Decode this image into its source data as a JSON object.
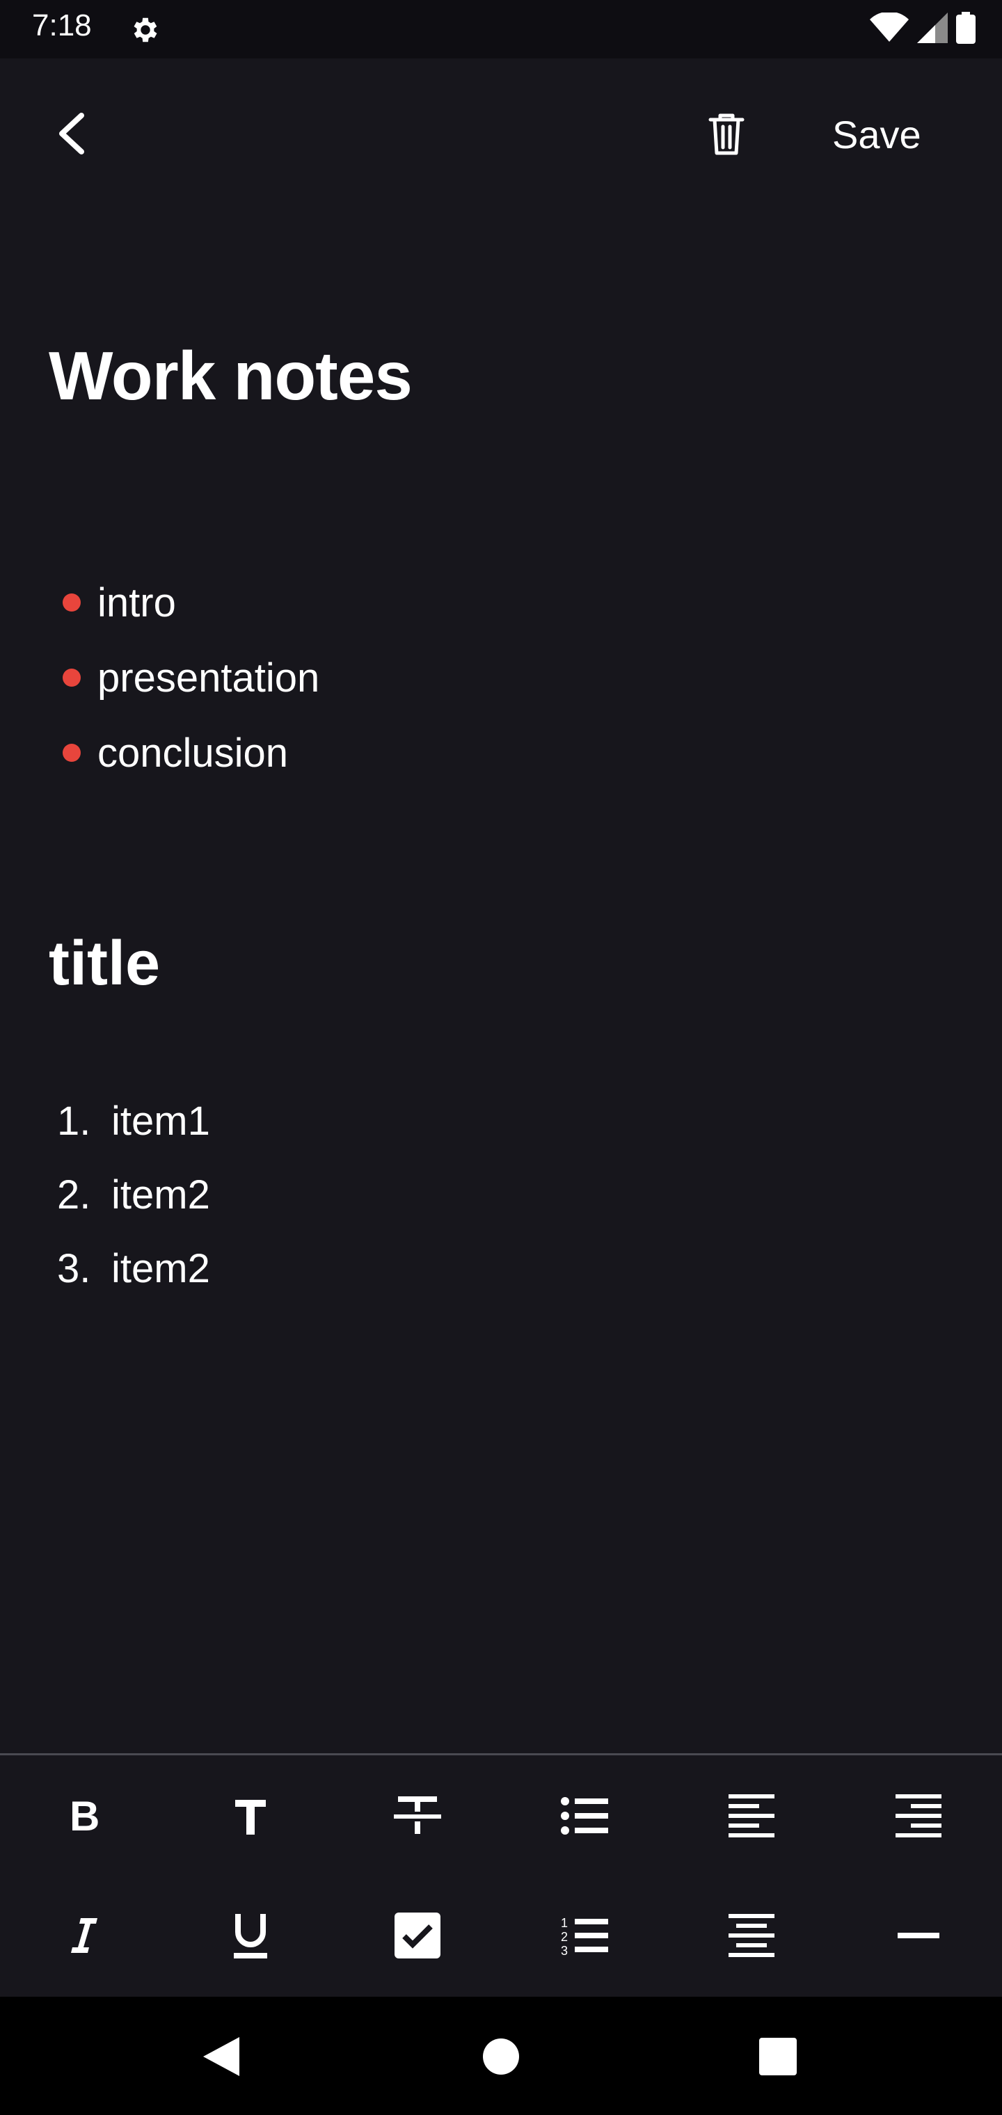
{
  "status": {
    "time": "7:18",
    "icons": [
      "gear-icon",
      "wifi-icon",
      "signal-icon",
      "battery-icon"
    ]
  },
  "appbar": {
    "back_icon": "chevron-left-icon",
    "delete_icon": "trash-icon",
    "save_label": "Save"
  },
  "note": {
    "title": "Work notes",
    "bullets": [
      "intro",
      "presentation",
      "conclusion"
    ],
    "subtitle": "title",
    "numbered": [
      {
        "num": "1.",
        "text": "item1"
      },
      {
        "num": "2.",
        "text": "item2"
      },
      {
        "num": "3.",
        "text": "item2"
      }
    ]
  },
  "toolbar": {
    "row1": [
      "bold-icon",
      "text-size-icon",
      "strikethrough-icon",
      "bullet-list-icon",
      "align-left-icon",
      "align-right-icon"
    ],
    "row2": [
      "italic-icon",
      "underline-icon",
      "checkbox-icon",
      "numbered-list-icon",
      "align-center-icon",
      "horizontal-rule-icon"
    ]
  },
  "colors": {
    "background": "#17161c",
    "bullet": "#e8453c",
    "text": "#ffffff"
  },
  "navbar": {
    "icons": [
      "nav-back-icon",
      "nav-home-icon",
      "nav-recents-icon"
    ]
  }
}
